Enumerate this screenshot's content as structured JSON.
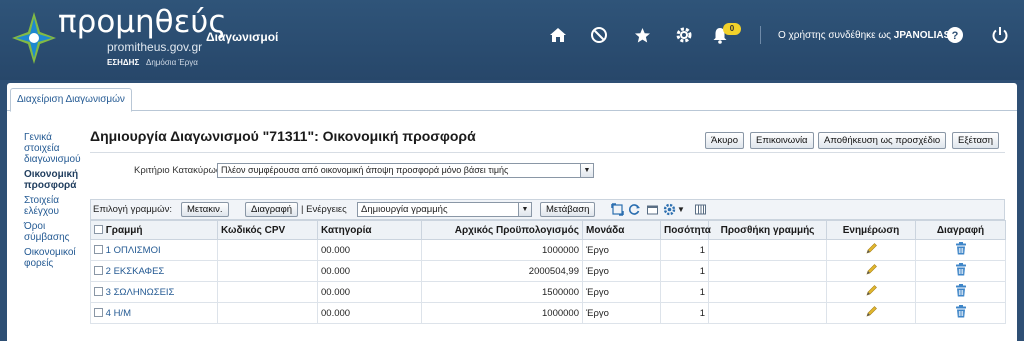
{
  "brand": {
    "wordmark": "προμηθεύς",
    "url": "promitheus.gov.gr",
    "section": "Διαγωνισμοί",
    "esidis": "ΕΣΗΔΗΣ",
    "public_works": "Δημόσια Έργα"
  },
  "header": {
    "notifications_count": "0",
    "user_prefix": "Ο χρήστης συνδέθηκε ως",
    "username": "JPANOLIAS"
  },
  "tabs": [
    "Διαχείριση Διαγωνισμών"
  ],
  "sidenav": [
    {
      "label": "Γενικά στοιχεία διαγωνισμού"
    },
    {
      "label": "Οικονομική προσφορά"
    },
    {
      "label": "Στοιχεία ελέγχου"
    },
    {
      "label": "Όροι σύμβασης"
    },
    {
      "label": "Οικονομικοί φορείς"
    }
  ],
  "page": {
    "title": "Δημιουργία Διαγωνισμού \"71311\": Οικονομική προσφορά",
    "buttons": {
      "cancel": "Άκυρο",
      "contact": "Επικοινωνία",
      "save_draft": "Αποθήκευση ως προσχέδιο",
      "review": "Εξέταση"
    },
    "criterion_label": "Κριτήριο Κατακύρωσης",
    "criterion_value": "Πλέον συμφέρουσα από οικονομική άποψη προσφορά μόνο βάσει τιμής"
  },
  "toolbar": {
    "select_rows_label": "Επιλογή γραμμών:",
    "move_button": "Μετακιν.",
    "delete_button": "Διαγραφή",
    "actions_label": "| Ενέργειες",
    "actions_value": "Δημιουργία γραμμής",
    "go_button": "Μετάβαση"
  },
  "table": {
    "columns": [
      "Γραμμή",
      "Κωδικός CPV",
      "Κατηγορία",
      "Αρχικός Προϋπολογισμός",
      "Μονάδα",
      "Ποσότητα",
      "Προσθήκη γραμμής",
      "Ενημέρωση",
      "Διαγραφή"
    ],
    "rows": [
      {
        "line": "1 ΟΠΛΙΣΜΟΙ",
        "cpv": "",
        "category": "00.000",
        "budget": "1000000",
        "unit": "Έργο",
        "quantity": "1"
      },
      {
        "line": "2 ΕΚΣΚΑΦΕΣ",
        "cpv": "",
        "category": "00.000",
        "budget": "2000504,99",
        "unit": "Έργο",
        "quantity": "1"
      },
      {
        "line": "3 ΣΩΛΗΝΩΣΕΙΣ",
        "cpv": "",
        "category": "00.000",
        "budget": "1500000",
        "unit": "Έργο",
        "quantity": "1"
      },
      {
        "line": "4 Η/Μ",
        "cpv": "",
        "category": "00.000",
        "budget": "1000000",
        "unit": "Έργο",
        "quantity": "1"
      }
    ]
  },
  "colors": {
    "header_bg": "#2e4f74",
    "link": "#245a93",
    "badge": "#f2d22b",
    "edit_icon": "#e2b82e",
    "trash_icon": "#3f86c8"
  },
  "icons": [
    "home-icon",
    "block-icon",
    "star-icon",
    "gear-icon",
    "bell-icon",
    "help-icon",
    "power-icon",
    "pencil-icon",
    "trash-icon"
  ]
}
